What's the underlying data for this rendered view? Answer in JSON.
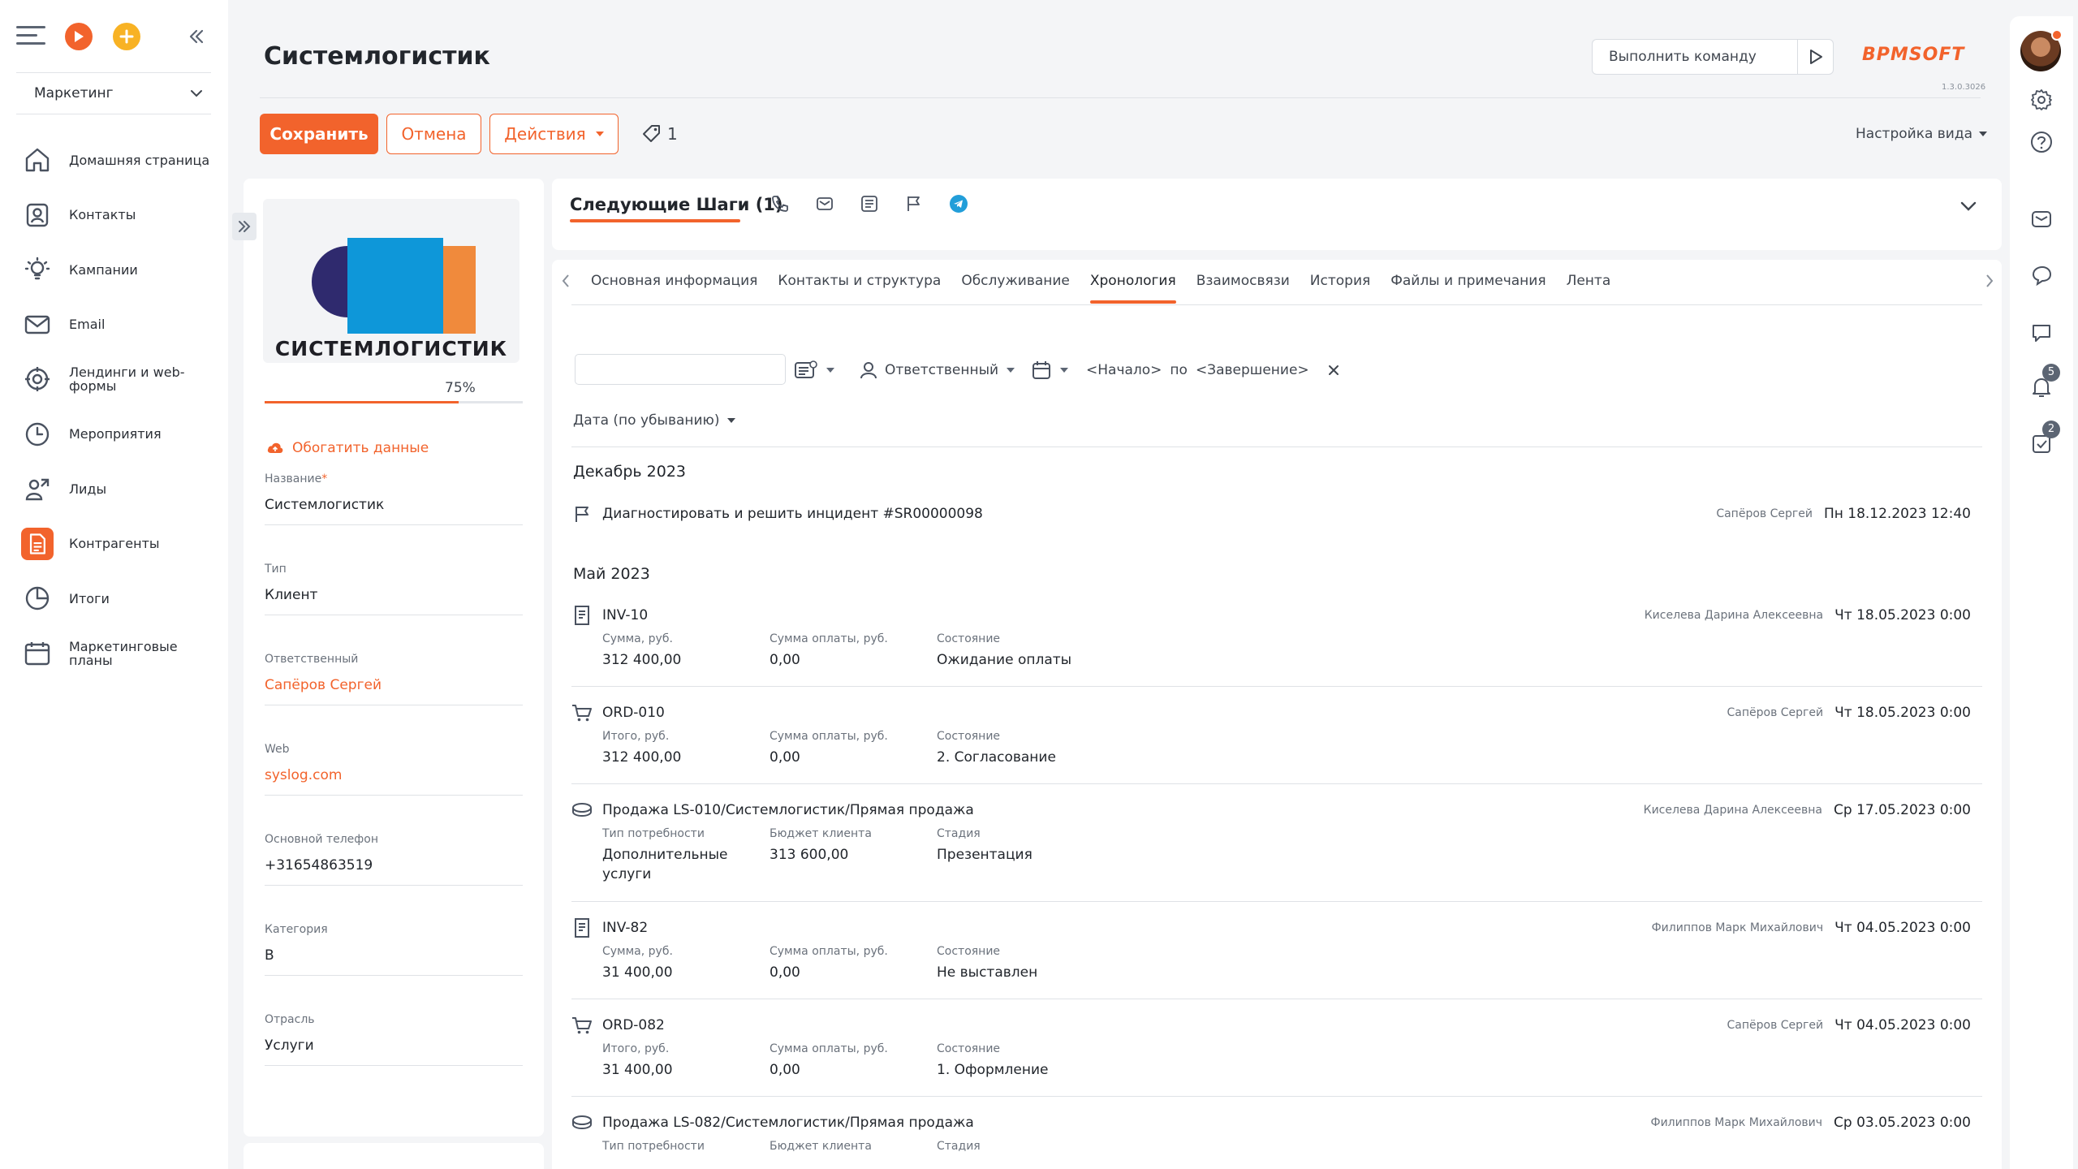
{
  "sidebar": {
    "workspace": "Маркетинг",
    "items": [
      {
        "label": "Домашняя страница",
        "icon": "home-icon"
      },
      {
        "label": "Контакты",
        "icon": "contact-icon"
      },
      {
        "label": "Кампании",
        "icon": "lightbulb-icon"
      },
      {
        "label": "Email",
        "icon": "mail-icon"
      },
      {
        "label": "Лендинги и web-формы",
        "icon": "target-icon"
      },
      {
        "label": "Мероприятия",
        "icon": "clock-icon"
      },
      {
        "label": "Лиды",
        "icon": "lead-icon"
      },
      {
        "label": "Контрагенты",
        "icon": "document-icon"
      },
      {
        "label": "Итоги",
        "icon": "pie-chart-icon"
      },
      {
        "label": "Маркетинговые планы",
        "icon": "calendar-icon"
      }
    ]
  },
  "header": {
    "title": "Системлогистик",
    "command_placeholder": "Выполнить команду",
    "logo": "BPMSOFT",
    "version": "1.3.0.3026",
    "save": "Сохранить",
    "cancel": "Отмена",
    "actions": "Действия",
    "tag_count": "1",
    "view_settings": "Настройка вида"
  },
  "profile": {
    "company_logo_text": "СИСТЕМЛОГИСТИК",
    "completeness": "75%",
    "enrich": "Обогатить данные",
    "fields": [
      {
        "label": "Название",
        "value": "Системлогистик",
        "required": "*"
      },
      {
        "label": "Тип",
        "value": "Клиент"
      },
      {
        "label": "Ответственный",
        "value": "Сапёров Сергей"
      },
      {
        "label": "Web",
        "value": "syslog.com"
      },
      {
        "label": "Основной телефон",
        "value": "+31654863519"
      },
      {
        "label": "Категория",
        "value": "B"
      },
      {
        "label": "Отрасль",
        "value": "Услуги"
      }
    ]
  },
  "next_steps": {
    "title": "Следующие Шаги (1)"
  },
  "tabs": [
    "Основная информация",
    "Контакты и структура",
    "Обслуживание",
    "Хронология",
    "Взаимосвязи",
    "История",
    "Файлы и примечания",
    "Лента"
  ],
  "filters": {
    "owner": "Ответственный",
    "start": "<Начало>",
    "by": "по",
    "end": "<Завершение>",
    "sort": "Дата (по убыванию)"
  },
  "timeline": {
    "months": [
      "Декабрь 2023",
      "Май 2023"
    ],
    "items": [
      {
        "icon": "flag-icon",
        "title": "Диагностировать и решить инцидент #SR00000098",
        "owner": "Сапёров Сергей",
        "date": "Пн 18.12.2023 12:40"
      },
      {
        "icon": "invoice-icon",
        "title": "INV-10",
        "owner": "Киселева Дарина Алексеевна",
        "date": "Чт 18.05.2023 0:00",
        "f1_label": "Сумма, руб.",
        "f1_value": "312 400,00",
        "f2_label": "Сумма оплаты, руб.",
        "f2_value": "0,00",
        "f3_label": "Состояние",
        "f3_value": "Ожидание оплаты"
      },
      {
        "icon": "cart-icon",
        "title": "ORD-010",
        "owner": "Сапёров Сергей",
        "date": "Чт 18.05.2023 0:00",
        "f1_label": "Итого, руб.",
        "f1_value": "312 400,00",
        "f2_label": "Сумма оплаты, руб.",
        "f2_value": "0,00",
        "f3_label": "Состояние",
        "f3_value": "2. Согласование"
      },
      {
        "icon": "coins-icon",
        "title": "Продажа LS-010/Системлогистик/Прямая продажа",
        "owner": "Киселева Дарина Алексеевна",
        "date": "Ср 17.05.2023 0:00",
        "f1_label": "Тип потребности",
        "f1_value": "Дополнительные услуги",
        "f2_label": "Бюджет клиента",
        "f2_value": "313 600,00",
        "f3_label": "Стадия",
        "f3_value": "Презентация"
      },
      {
        "icon": "invoice-icon",
        "title": "INV-82",
        "owner": "Филиппов Марк Михайлович",
        "date": "Чт 04.05.2023 0:00",
        "f1_label": "Сумма, руб.",
        "f1_value": "31 400,00",
        "f2_label": "Сумма оплаты, руб.",
        "f2_value": "0,00",
        "f3_label": "Состояние",
        "f3_value": "Не выставлен"
      },
      {
        "icon": "cart-icon",
        "title": "ORD-082",
        "owner": "Сапёров Сергей",
        "date": "Чт 04.05.2023 0:00",
        "f1_label": "Итого, руб.",
        "f1_value": "31 400,00",
        "f2_label": "Сумма оплаты, руб.",
        "f2_value": "0,00",
        "f3_label": "Состояние",
        "f3_value": "1. Оформление"
      },
      {
        "icon": "coins-icon",
        "title": "Продажа LS-082/Системлогистик/Прямая продажа",
        "owner": "Филиппов Марк Михайлович",
        "date": "Ср 03.05.2023 0:00",
        "f1_label": "Тип потребности",
        "f2_label": "Бюджет клиента",
        "f3_label": "Стадия"
      }
    ]
  },
  "rightbar": {
    "notifications": "5",
    "tasks": "2"
  },
  "colors": {
    "accent": "#f2632c",
    "text": "#22262c",
    "muted": "#6b727c",
    "background": "#f4f5f7"
  }
}
